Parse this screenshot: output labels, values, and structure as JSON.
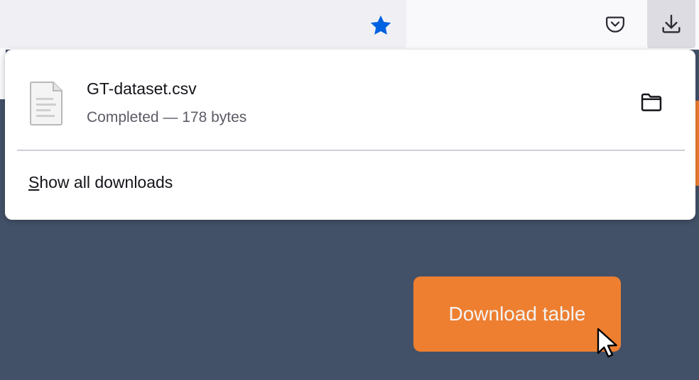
{
  "toolbar": {
    "bookmark_icon": "star-icon",
    "bookmark_color": "#0061e0",
    "pocket_icon": "pocket-icon",
    "downloads_icon": "download-arrow-icon"
  },
  "downloads_panel": {
    "item": {
      "file_name": "GT-dataset.csv",
      "status": "Completed — 178 bytes",
      "file_icon": "document-icon",
      "folder_icon": "folder-icon"
    },
    "show_all": {
      "access_key": "S",
      "rest": "how all downloads"
    }
  },
  "page": {
    "download_button_label": "Download table",
    "button_color": "#ee7f30",
    "background_color": "#435168"
  },
  "cursor_icon": "pointer-cursor-icon"
}
